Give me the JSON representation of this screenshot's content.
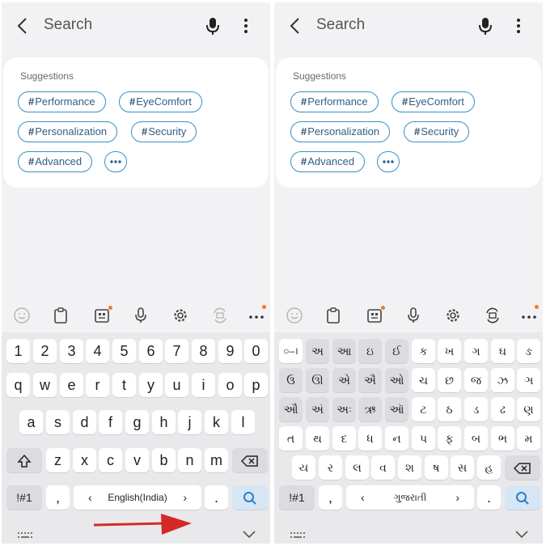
{
  "appbar": {
    "title": "Search"
  },
  "suggestions": {
    "title": "Suggestions",
    "chips": [
      "Performance",
      "EyeComfort",
      "Personalization",
      "Security",
      "Advanced"
    ]
  },
  "keyboard_en": {
    "numbers": [
      "1",
      "2",
      "3",
      "4",
      "5",
      "6",
      "7",
      "8",
      "9",
      "0"
    ],
    "row1": [
      "q",
      "w",
      "e",
      "r",
      "t",
      "y",
      "u",
      "i",
      "o",
      "p"
    ],
    "row2": [
      "a",
      "s",
      "d",
      "f",
      "g",
      "h",
      "j",
      "k",
      "l"
    ],
    "row3": [
      "z",
      "x",
      "c",
      "v",
      "b",
      "n",
      "m"
    ],
    "sym_label": "!#1",
    "comma": ",",
    "period": ".",
    "space_label": "English(India)"
  },
  "keyboard_gu": {
    "row1": [
      "○–।",
      "અ",
      "આ",
      "ઇ",
      "ઈ",
      "ક",
      "ખ",
      "ગ",
      "ઘ",
      "ઙ"
    ],
    "row2": [
      "ઉ",
      "ઊ",
      "એ",
      "ઐ",
      "ઓ",
      "ચ",
      "છ",
      "જ",
      "ઝ",
      "ઞ"
    ],
    "row3": [
      "ઔ",
      "અં",
      "અઃ",
      "ઋ",
      "ઑ",
      "ટ",
      "ઠ",
      "ડ",
      "ઢ",
      "ણ"
    ],
    "row4": [
      "ત",
      "થ",
      "દ",
      "ધ",
      "ન",
      "પ",
      "ફ",
      "બ",
      "ભ",
      "મ"
    ],
    "row5": [
      "ય",
      "ર",
      "લ",
      "વ",
      "શ",
      "ષ",
      "સ",
      "હ"
    ],
    "sym_label": "!#1",
    "comma": ",",
    "period": ".",
    "space_label": "ગુજરાતી"
  },
  "colors": {
    "accent_blue": "#3a8fc4",
    "arrow_red": "#d42a25",
    "notification_dot": "#f07b22"
  },
  "icons": [
    "back-arrow-icon",
    "mic-icon",
    "more-vert-icon",
    "emoji-icon",
    "clipboard-icon",
    "keyboard-mode-icon",
    "voice-input-icon",
    "settings-icon",
    "translate-icon",
    "more-horiz-icon",
    "shift-icon",
    "backspace-icon",
    "search-icon",
    "chevron-down-icon",
    "keyboard-handle-icon"
  ]
}
